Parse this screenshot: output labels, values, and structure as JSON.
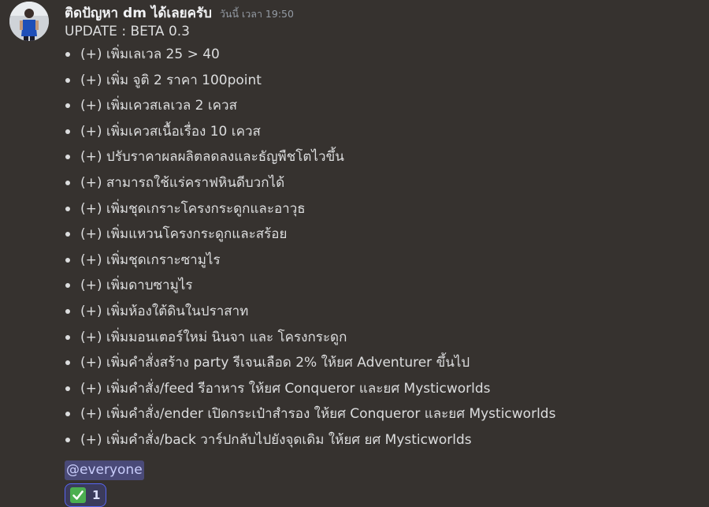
{
  "message": {
    "author": "ติดปัญหา dm ได้เลยครับ",
    "timestamp": "วันนี้ เวลา 19:50",
    "version_line": "UPDATE : BETA 0.3",
    "items": [
      "(+) เพิ่มเลเวล 25 > 40",
      "(+) เพิ่ม จูติ 2 ราคา 100point",
      "(+) เพิ่มเควสเลเวล 2 เควส",
      "(+) เพิ่มเควสเนื้อเรื่อง 10 เควส",
      "(+) ปรับราคาผลผลิตลดลงและธัญพืชโตไวขึ้น",
      "(+) สามารถใช้แร่คราฟหินดีบวกได้",
      "(+) เพิ่มชุดเกราะโครงกระดูกและอาวุธ",
      "(+) เพิ่มแหวนโครงกระดูกและสร้อย",
      "(+) เพิ่มชุดเกราะซามูไร",
      "(+) เพิ่มดาบซามูไร",
      "(+) เพิ่มห้องใต้ดินในปราสาท",
      "(+) เพิ่มมอนเตอร์ใหม่ นินจา และ โครงกระดูก",
      "(+) เพิ่มคำสั่งสร้าง party รีเจนเลือด 2% ให้ยศ Adventurer ขึ้นไป",
      "(+) เพิ่มคำสั่ง/feed รีอาหาร ให้ยศ Conqueror และยศ Mysticworlds",
      "(+) เพิ่มคำสั่ง/ender เปิดกระเป๋าสำรอง ให้ยศ Conqueror และยศ Mysticworlds",
      "(+) เพิ่มคำสั่ง/back วาร์ปกลับไปยังจุดเดิม ให้ยศ ยศ Mysticworlds"
    ],
    "mention": "@everyone",
    "reaction": {
      "emoji": "white-check-mark",
      "count": "1"
    }
  },
  "colors": {
    "background": "#36322f",
    "text": "#dcddde",
    "mention_bg": "#4a4a78",
    "mention_text": "#c9cdfb",
    "reaction_border": "#5865f2",
    "check_green": "#4caf50"
  }
}
